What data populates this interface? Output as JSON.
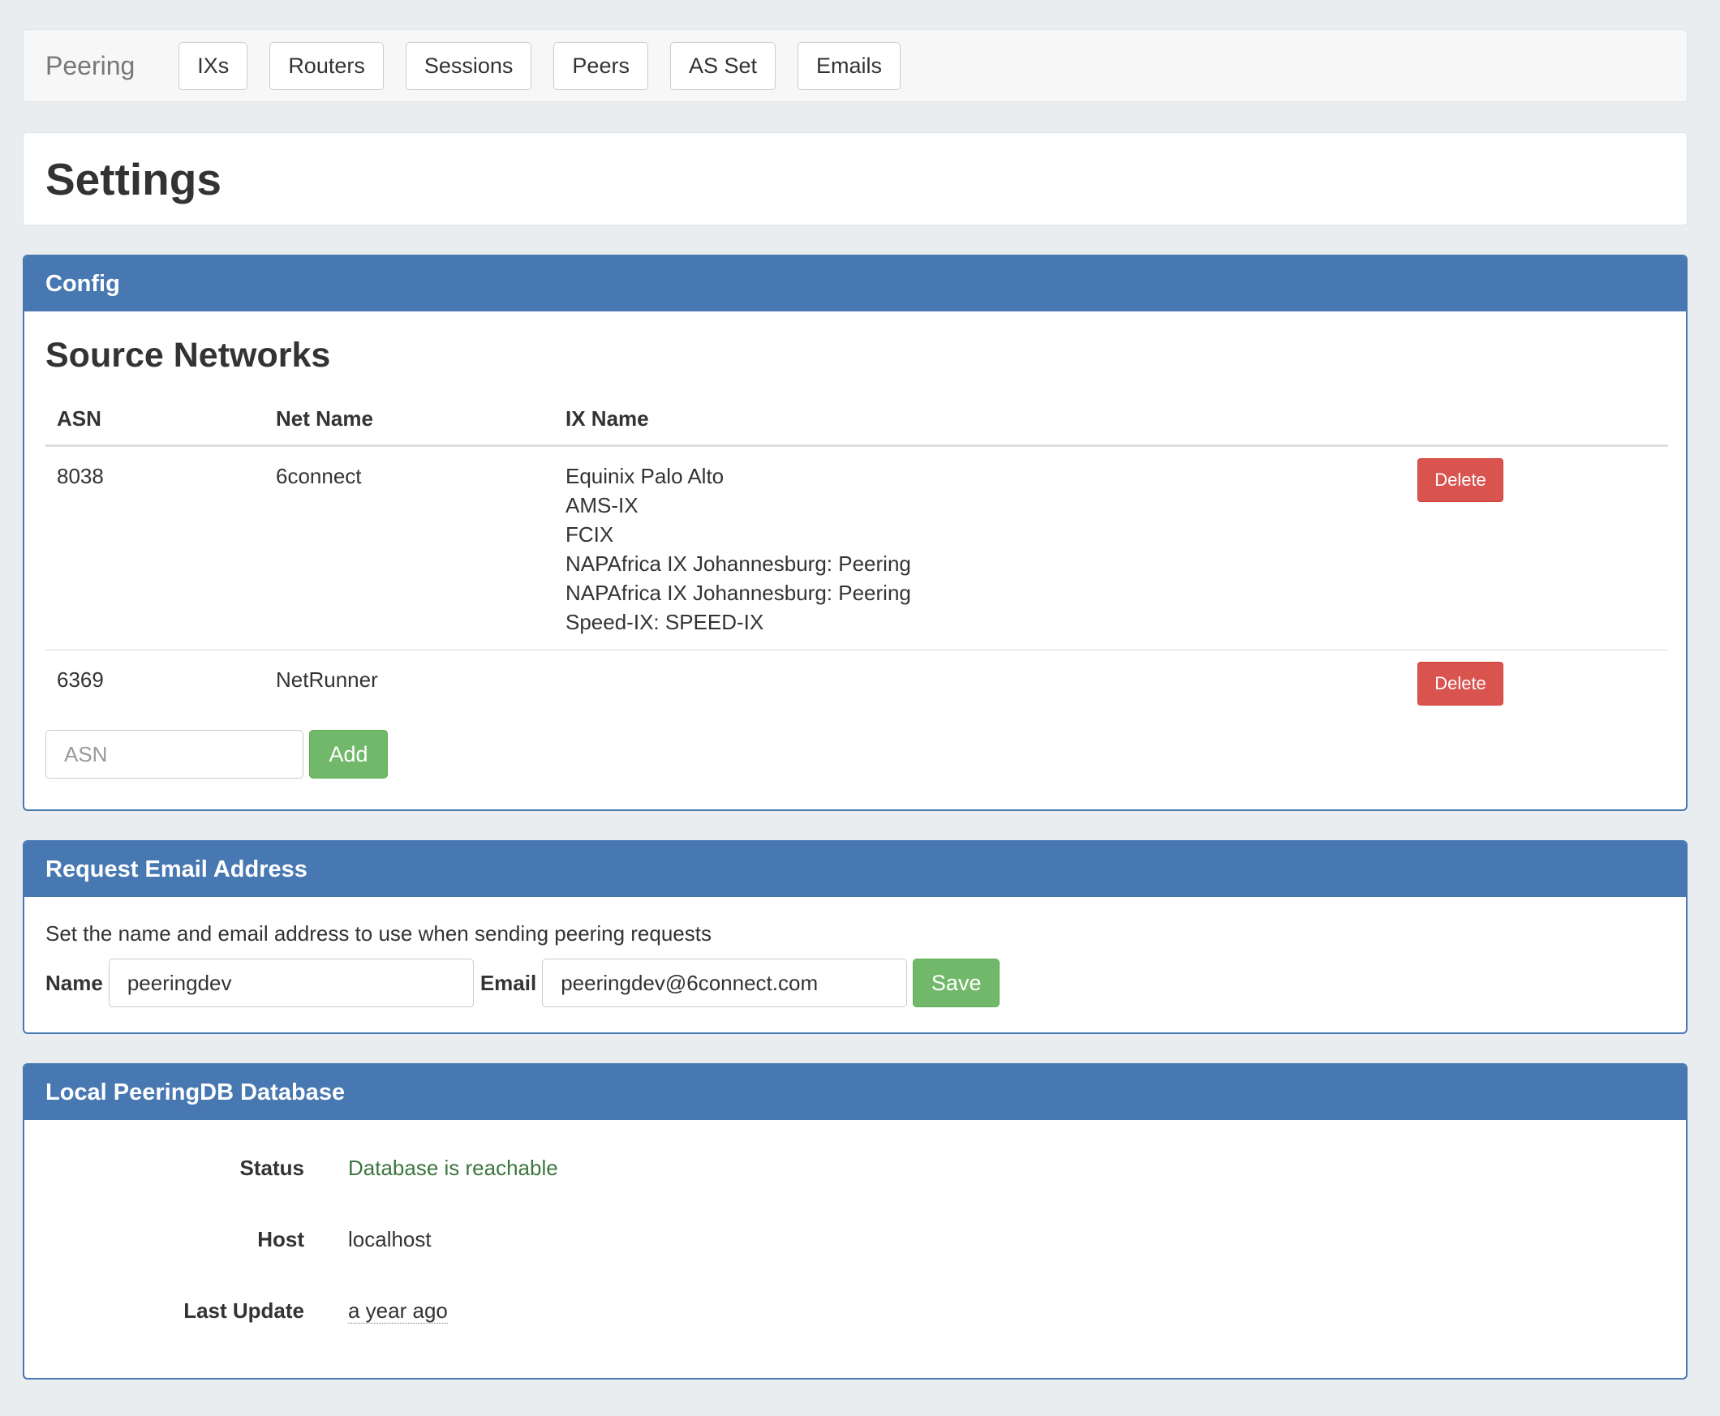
{
  "navbar": {
    "brand": "Peering",
    "items": [
      "IXs",
      "Routers",
      "Sessions",
      "Peers",
      "AS Set",
      "Emails"
    ]
  },
  "page": {
    "title": "Settings"
  },
  "config_panel": {
    "heading": "Config",
    "section_title": "Source Networks",
    "columns": [
      "ASN",
      "Net Name",
      "IX Name"
    ],
    "rows": [
      {
        "asn": "8038",
        "net_name": "6connect",
        "ix_names": [
          "Equinix Palo Alto",
          "AMS-IX",
          "FCIX",
          "NAPAfrica IX Johannesburg: Peering",
          "NAPAfrica IX Johannesburg: Peering",
          "Speed-IX: SPEED-IX"
        ],
        "delete_label": "Delete"
      },
      {
        "asn": "6369",
        "net_name": "NetRunner",
        "ix_names": [],
        "delete_label": "Delete"
      }
    ],
    "asn_input_placeholder": "ASN",
    "add_label": "Add"
  },
  "email_panel": {
    "heading": "Request Email Address",
    "description": "Set the name and email address to use when sending peering requests",
    "name_label": "Name",
    "name_value": "peeringdev",
    "email_label": "Email",
    "email_value": "peeringdev@6connect.com",
    "save_label": "Save"
  },
  "db_panel": {
    "heading": "Local PeeringDB Database",
    "status_label": "Status",
    "status_value": "Database is reachable",
    "host_label": "Host",
    "host_value": "localhost",
    "last_update_label": "Last Update",
    "last_update_value": "a year ago"
  },
  "colors": {
    "panel_primary": "#4778b2",
    "danger": "#d9534f",
    "success": "#72b86a",
    "status_ok_text": "#3c763d",
    "page_background": "#e9edf0"
  }
}
